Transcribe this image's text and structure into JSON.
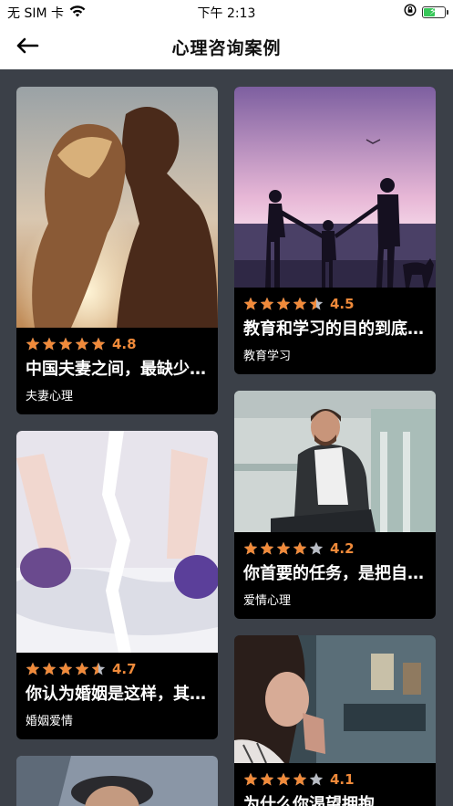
{
  "status_bar": {
    "carrier": "无 SIM 卡",
    "time": "下午 2:13",
    "battery_level": 0.55,
    "icons": [
      "wifi-icon",
      "orientation-lock-icon",
      "battery-charging-icon"
    ]
  },
  "nav": {
    "back_icon": "arrow-left-icon",
    "title": "心理咨询案例"
  },
  "colors": {
    "background": "#3b4048",
    "card": "#000000",
    "star_filled": "#f08a3a",
    "star_empty": "#b8bcc4",
    "rating_text": "#f08a3a"
  },
  "cards": [
    {
      "rating": 4.8,
      "rating_label": "4.8",
      "title": "中国夫妻之间，最缺少的是什么",
      "tag": "夫妻心理",
      "image": "couple-sunset-photo"
    },
    {
      "rating": 4.5,
      "rating_label": "4.5",
      "title": "教育和学习的目的到底是什么",
      "tag": "教育学习",
      "image": "family-silhouette-photo"
    },
    {
      "rating": 4.2,
      "rating_label": "4.2",
      "title": "你首要的任务，是把自己照顾好",
      "tag": "爱情心理",
      "image": "smiling-man-photo"
    },
    {
      "rating": 4.7,
      "rating_label": "4.7",
      "title": "你认为婚姻是这样，其实不是",
      "tag": "婚姻爱情",
      "image": "broken-couple-photo"
    },
    {
      "rating": 4.1,
      "rating_label": "4.1",
      "title": "为什么你渴望拥抱",
      "tag": "",
      "image": "praying-woman-photo"
    },
    {
      "rating": null,
      "rating_label": "",
      "title": "",
      "tag": "",
      "image": "man-with-hat-photo"
    }
  ]
}
